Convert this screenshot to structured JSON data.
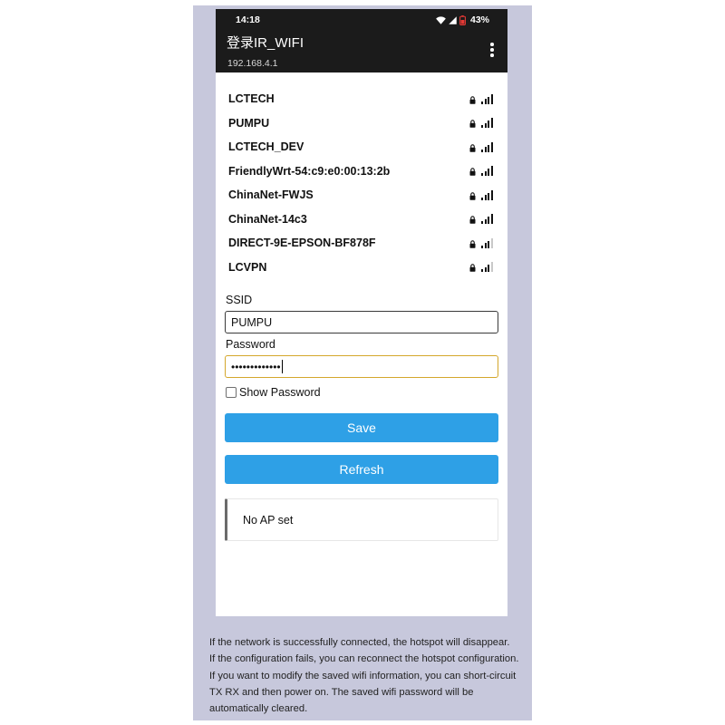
{
  "status_bar": {
    "time": "14:18",
    "battery_text": "43%",
    "icons": [
      "wifi-icon",
      "cell-signal-icon",
      "battery-icon"
    ]
  },
  "app_bar": {
    "title": "登录IR_WIFI",
    "subtitle": "192.168.4.1",
    "menu_icon": "more-vertical-icon"
  },
  "networks": [
    {
      "ssid": "LCTECH",
      "secured": true,
      "signal_bars": 4
    },
    {
      "ssid": "PUMPU",
      "secured": true,
      "signal_bars": 4
    },
    {
      "ssid": "LCTECH_DEV",
      "secured": true,
      "signal_bars": 4
    },
    {
      "ssid": "FriendlyWrt-54:c9:e0:00:13:2b",
      "secured": true,
      "signal_bars": 4
    },
    {
      "ssid": "ChinaNet-FWJS",
      "secured": true,
      "signal_bars": 4
    },
    {
      "ssid": "ChinaNet-14c3",
      "secured": true,
      "signal_bars": 4
    },
    {
      "ssid": "DIRECT-9E-EPSON-BF878F",
      "secured": true,
      "signal_bars": 3
    },
    {
      "ssid": "LCVPN",
      "secured": true,
      "signal_bars": 3
    }
  ],
  "network_icons": {
    "security": "lock-icon",
    "strength": "signal-bars-icon"
  },
  "form": {
    "ssid_label": "SSID",
    "ssid_value": "PUMPU",
    "password_label": "Password",
    "password_masked": "•••••••••••••",
    "password_focused": true,
    "show_password_label": "Show Password",
    "show_password_checked": false,
    "save_label": "Save",
    "refresh_label": "Refresh"
  },
  "message": {
    "text": "No AP set"
  },
  "footer_lines": [
    "If the network is successfully connected, the hotspot will disappear.",
    "If the configuration fails, you can reconnect the hotspot configuration.",
    "If you want to modify the saved wifi information, you can short-circuit",
    "TX RX and then power on. The saved wifi password will be",
    "automatically cleared."
  ],
  "colors": {
    "panel_background": "#c7c8dc",
    "app_bar_background": "#1b1b1b",
    "button_accent": "#2ea0e6",
    "focus_border": "#d4a72c",
    "battery": "#e53935"
  }
}
